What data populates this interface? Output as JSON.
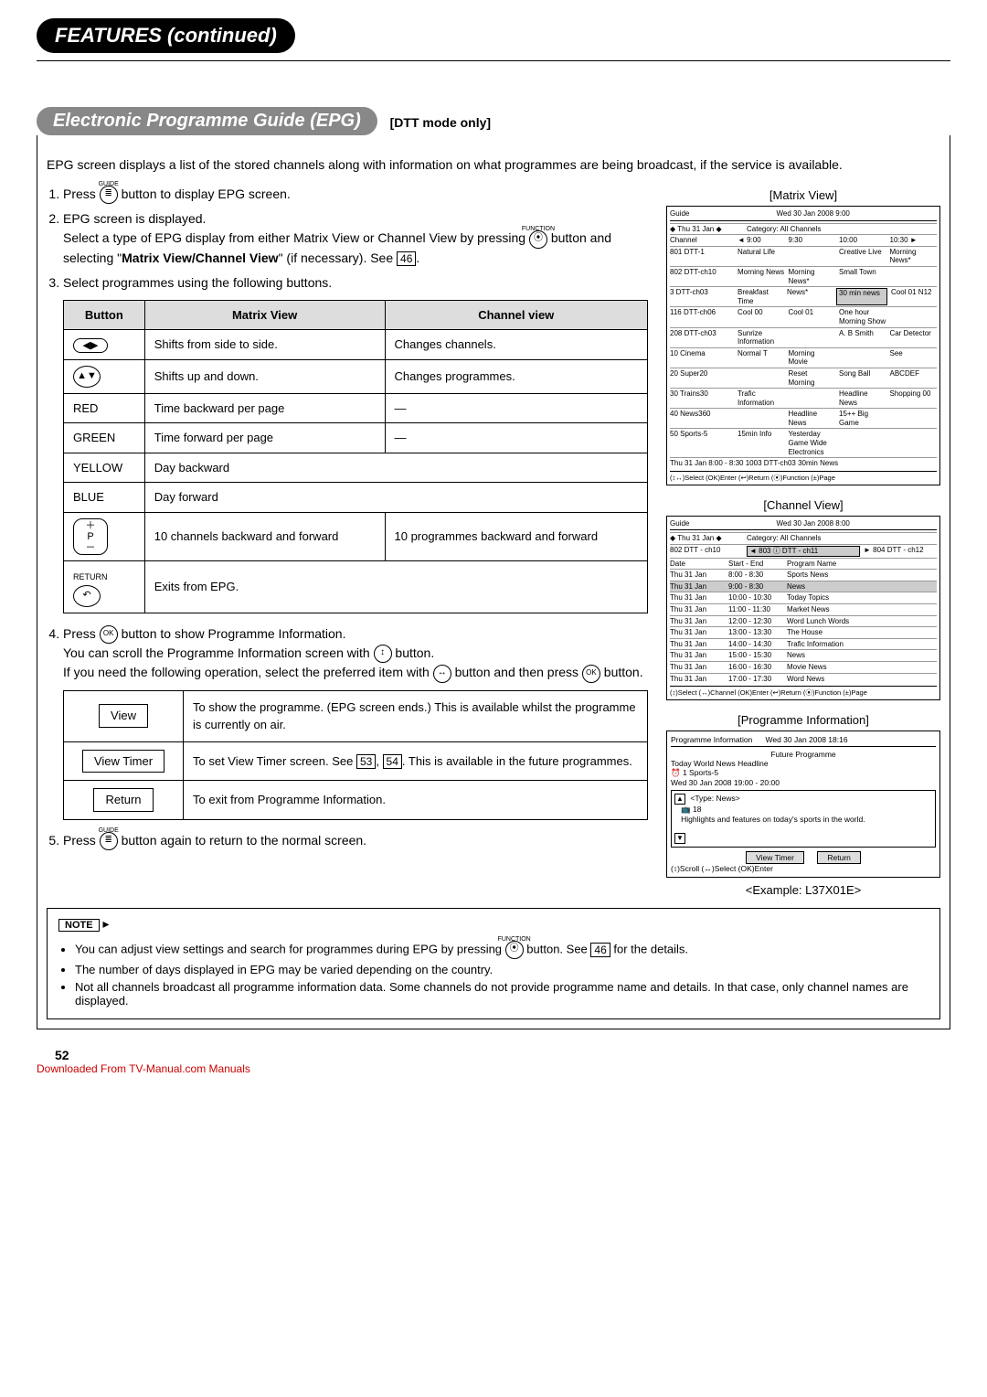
{
  "header": {
    "featuresTitle": "FEATURES (continued)",
    "epgTitle": "Electronic Programme Guide (EPG)",
    "dttNote": "[DTT mode only]"
  },
  "intro": "EPG screen displays a list of the stored channels along with information on what programmes are being broadcast, if the service is available.",
  "steps": {
    "s1a": "Press ",
    "s1b": " button to display EPG screen.",
    "s2": "EPG screen is displayed.",
    "s2sub_a": "Select a type of EPG display from either Matrix View or Channel View by pressing ",
    "s2sub_b": " button and selecting \"",
    "s2sub_bold": "Matrix View/Channel View",
    "s2sub_c": "\" (if necessary). See ",
    "s2sub_d": ".",
    "s3": "Select programmes using the following buttons.",
    "s4a": "Press ",
    "s4b": " button to show Programme Information.",
    "s4sub1a": "You can scroll the Programme Information screen with ",
    "s4sub1b": " button.",
    "s4sub2a": "If you need the following operation, select the preferred item with ",
    "s4sub2b": " button and then press ",
    "s4sub2c": " button.",
    "s5a": "Press ",
    "s5b": " button again to return to the normal screen."
  },
  "pageRef46": "46",
  "pageRef53": "53",
  "pageRef54": "54",
  "btnTable": {
    "h1": "Button",
    "h2": "Matrix View",
    "h3": "Channel view",
    "r1a": "Shifts from side to side.",
    "r1b": "Changes channels.",
    "r2a": "Shifts up and down.",
    "r2b": "Changes programmes.",
    "r3_btn": "RED",
    "r3a": "Time backward per page",
    "r3b": "—",
    "r4_btn": "GREEN",
    "r4a": "Time forward per page",
    "r4b": "—",
    "r5_btn": "YELLOW",
    "r5a": "Day backward",
    "r6_btn": "BLUE",
    "r6a": "Day forward",
    "r7a": "10 channels backward and forward",
    "r7b": "10 programmes backward and forward",
    "r8a": "Exits from EPG."
  },
  "viewTable": {
    "view": "View",
    "viewDesc": "To show the programme. (EPG screen ends.) This is available whilst the programme is currently on air.",
    "viewTimer": "View Timer",
    "viewTimerDesc_a": "To set View Timer screen. See ",
    "viewTimerDesc_b": ", ",
    "viewTimerDesc_c": ". This is available in the future programmes.",
    "return": "Return",
    "returnDesc": "To exit from Programme Information."
  },
  "note": {
    "label": "NOTE",
    "n1a": "You can adjust view settings and search for programmes during EPG by pressing ",
    "n1b": " button. See ",
    "n1c": " for the details.",
    "n2": "The number of days displayed in EPG may be varied depending on the country.",
    "n3": "Not all channels broadcast all programme information data. Some channels do not provide programme name and details. In that case, only channel names are displayed."
  },
  "matrixView": {
    "title": "[Matrix View]",
    "guide": "Guide",
    "datetime": "Wed 30 Jan 2008     9:00",
    "navDate": "◆ Thu 31 Jan  ◆",
    "category": "Category: All Channels",
    "channelHdr": "Channel",
    "times": [
      "9:00",
      "9:30",
      "10:00",
      "10:30"
    ],
    "rows": [
      {
        "ch": "801  DTT-1",
        "progs": [
          "Natural Life",
          "",
          "Creative Live",
          "Morning News*"
        ]
      },
      {
        "ch": "802  DTT-ch10",
        "progs": [
          "Morning News",
          "Morning News*",
          "Small Town",
          ""
        ]
      },
      {
        "ch": "3  DTT-ch03",
        "progs": [
          "Breakfast Time",
          "News*",
          "30 min news",
          "Cool 01 N12"
        ]
      },
      {
        "ch": "116  DTT-ch06",
        "progs": [
          "Cool  00",
          "Cool  01",
          "One hour Morning Show",
          ""
        ]
      },
      {
        "ch": "208  DTT-ch03",
        "progs": [
          "Sunrize Information",
          "",
          "A. B Smith",
          "Car Detector"
        ]
      },
      {
        "ch": "10  Cinema",
        "progs": [
          "Normal T",
          "Morning Movie",
          "",
          "See"
        ]
      },
      {
        "ch": "20  Super20",
        "progs": [
          "",
          "Reset Morning",
          "Song   Ball",
          "ABCDEF"
        ]
      },
      {
        "ch": "30  Trains30",
        "progs": [
          "Trafic Information",
          "",
          "Headline News",
          "Shopping 00"
        ]
      },
      {
        "ch": "40  News360",
        "progs": [
          "",
          "Headline News",
          "15++  Big Game",
          ""
        ]
      },
      {
        "ch": "50  Sports-5",
        "progs": [
          "15min Info",
          "Yesterday Game Wide Electronics",
          "",
          ""
        ]
      }
    ],
    "footerLine": "Thu 31 Jan      8:00 - 8:30  1003  DTT-ch03  30min News",
    "footerHints": "(↕↔)Select  (OK)Enter  (↩)Return  (⦿)Function  (±)Page"
  },
  "channelView": {
    "title": "[Channel View]",
    "guide": "Guide",
    "datetime": "Wed 30 Jan 2008     8:00",
    "navDate": "◆ Thu 31 Jan  ◆",
    "category": "Category: All Channels",
    "chLeft": "802  DTT - ch10",
    "chMid": "◄ 803   ⓘ  DTT - ch11",
    "chRight": "► 804 DTT - ch12",
    "col1": "Date",
    "col2": "Start - End",
    "col3": "Program Name",
    "rows": [
      {
        "d": "Thu  31 Jan",
        "t": "8:00 -   8:30",
        "p": "Sports News"
      },
      {
        "d": "Thu  31 Jan",
        "t": "9:00 -   8:30",
        "p": "News",
        "hl": true
      },
      {
        "d": "Thu  31 Jan",
        "t": "10:00 - 10:30",
        "p": "Today Topics"
      },
      {
        "d": "Thu  31 Jan",
        "t": "11:00 - 11:30",
        "p": "Market News"
      },
      {
        "d": "Thu  31 Jan",
        "t": "12:00 - 12:30",
        "p": "Word Lunch Words"
      },
      {
        "d": "Thu  31 Jan",
        "t": "13:00 - 13:30",
        "p": "The House"
      },
      {
        "d": "Thu  31 Jan",
        "t": "14:00 - 14:30",
        "p": "Trafic Information"
      },
      {
        "d": "Thu  31 Jan",
        "t": "15:00 - 15:30",
        "p": "News"
      },
      {
        "d": "Thu  31 Jan",
        "t": "16:00 - 16:30",
        "p": "Movie News"
      },
      {
        "d": "Thu  31 Jan",
        "t": "17:00 - 17:30",
        "p": "Word News"
      }
    ],
    "footerHints": "(↕)Select  (↔)Channel  (OK)Enter  (↩)Return  (⦿)Function  (±)Page"
  },
  "progInfo": {
    "title": "[Programme Information]",
    "header": {
      "t": "Programme Information",
      "dt": "Wed 30 Jan 2008   18:16"
    },
    "futureProg": "Future Programme",
    "headline": "Today World News Headline",
    "chLine": "⏰  1      Sports-5",
    "timeLine": "Wed  30 Jan 2008              19:00 - 20:00",
    "typeLine": "<Type: News>",
    "chNum": "📺 18",
    "desc": "Highlights and features on today's sports in the world.",
    "btnView": "View Timer",
    "btnReturn": "Return",
    "footer": "(↕)Scroll  (↔)Select  (OK)Enter",
    "example": "<Example: L37X01E>"
  },
  "pageNum": "52",
  "downloadedFrom": "Downloaded From TV-Manual.com Manuals"
}
